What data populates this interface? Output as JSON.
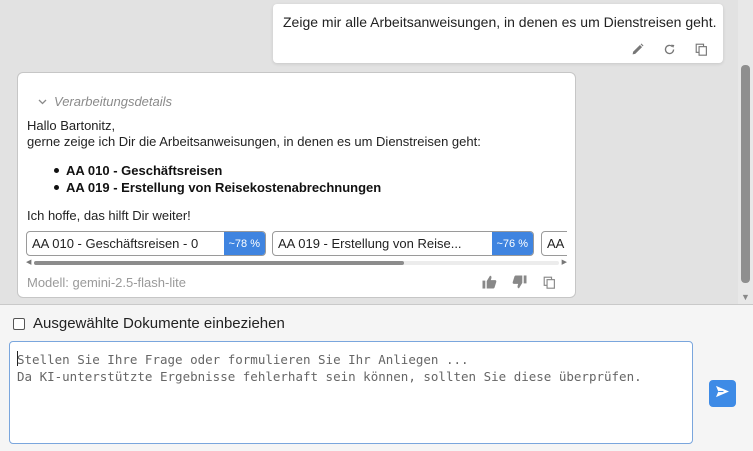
{
  "user_message": {
    "text": "Zeige mir alle Arbeitsanweisungen, in denen es um Dienstreisen geht.",
    "actions": [
      "edit-icon",
      "retry-icon",
      "copy-icon"
    ]
  },
  "bot_message": {
    "details_label": "Verarbeitungsdetails",
    "greeting_line1": "Hallo Bartonitz,",
    "greeting_line2": "gerne zeige ich Dir die Arbeitsanweisungen, in denen es um Dienstreisen geht:",
    "documents": [
      "AA 010 - Geschäftsreisen",
      "AA 019 - Erstellung von Reisekostenabrechnungen"
    ],
    "closing": "Ich hoffe, das hilft Dir weiter!",
    "sources": [
      {
        "label": "AA 010 - Geschäftsreisen - 0",
        "score": "~78 %"
      },
      {
        "label": "AA 019 - Erstellung von Reise...",
        "score": "~76 %"
      },
      {
        "label": "AA",
        "score": ""
      }
    ],
    "model": "Modell: gemini-2.5-flash-lite",
    "feedback": [
      "thumbs-up-icon",
      "thumbs-down-icon",
      "copy-icon"
    ]
  },
  "composer": {
    "include_label": "Ausgewählte Dokumente einbeziehen",
    "include_checked": false,
    "placeholder_line1": "Stellen Sie Ihre Frage oder formulieren Sie Ihr Anliegen ...",
    "placeholder_line2": "Da KI-unterstützte Ergebnisse fehlerhaft sein können, sollten Sie diese überprüfen."
  },
  "colors": {
    "accent": "#3e8be6",
    "score_badge": "#3f84e0",
    "input_border": "#7aa6dd"
  }
}
